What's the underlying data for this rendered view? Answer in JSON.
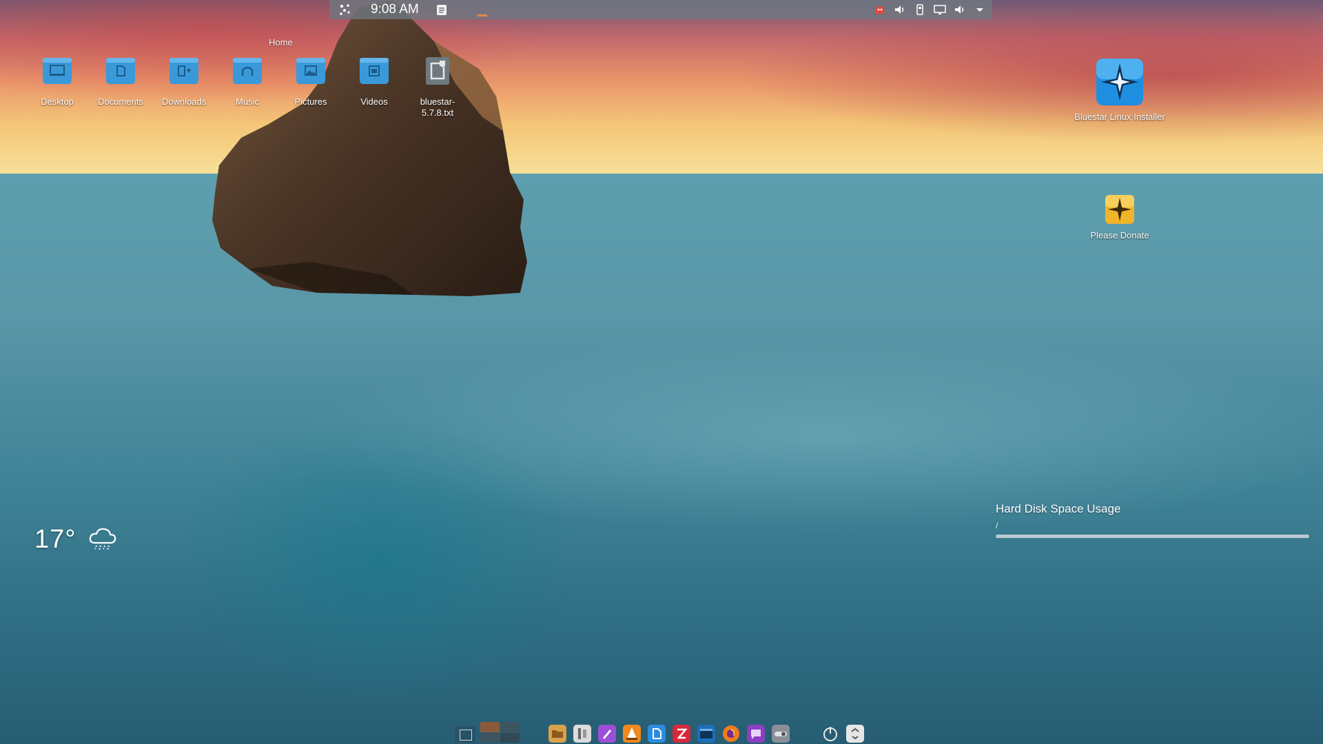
{
  "top_panel": {
    "clock": "9:08 AM",
    "tray_icons": [
      "network-icon",
      "volume-icon",
      "usb-device-icon",
      "display-icon",
      "speaker-icon",
      "expand-arrow-icon"
    ]
  },
  "desktop": {
    "home_label": "Home",
    "folders": [
      {
        "name": "desktop",
        "label": "Desktop",
        "icon": "desktop-folder-icon"
      },
      {
        "name": "documents",
        "label": "Documents",
        "icon": "documents-folder-icon"
      },
      {
        "name": "downloads",
        "label": "Downloads",
        "icon": "downloads-folder-icon"
      },
      {
        "name": "music",
        "label": "Music",
        "icon": "music-folder-icon"
      },
      {
        "name": "pictures",
        "label": "Pictures",
        "icon": "pictures-folder-icon"
      },
      {
        "name": "videos",
        "label": "Videos",
        "icon": "videos-folder-icon"
      },
      {
        "name": "bluestar-txt",
        "label": "bluestar-5.7.8.txt",
        "icon": "text-file-icon"
      }
    ],
    "installer_label": "Bluestar Linux Installer",
    "donate_label": "Please Donate"
  },
  "weather": {
    "temperature": "17°",
    "condition_icon": "cloud-rain-icon"
  },
  "disk_usage": {
    "title": "Hard Disk Space Usage",
    "mount": "/",
    "used_fraction": 0.0
  },
  "dock": {
    "apps": [
      "file-manager-icon",
      "settings-icon",
      "pen-icon",
      "vlc-icon",
      "kate-icon",
      "filezilla-icon",
      "terminal-icon",
      "firefox-icon",
      "chat-icon",
      "toggle-icon"
    ],
    "power_icon": "power-icon",
    "trash_icon": "trash-icon"
  },
  "colors": {
    "panel_bg": "#6e7882",
    "folder_blue": "#3a9ad9",
    "installer_blue": "#1e8fe0",
    "donate_yellow": "#f0b429"
  }
}
